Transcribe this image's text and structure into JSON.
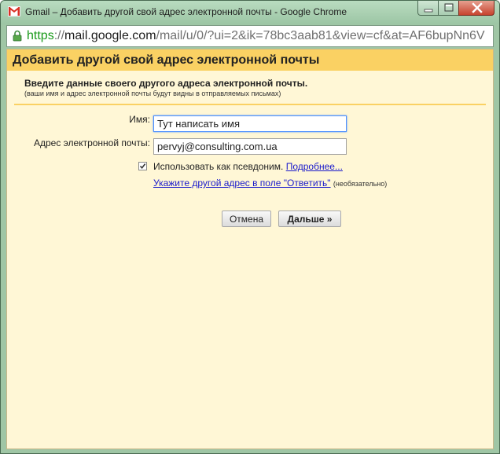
{
  "window": {
    "title": "Gmail – Добавить другой свой адрес электронной почты - Google Chrome",
    "logo_icon": "gmail-logo-icon",
    "controls": [
      "minimize-icon",
      "maximize-icon",
      "close-icon"
    ]
  },
  "addressbar": {
    "scheme": "https",
    "separator": "://",
    "host": "mail.google.com",
    "path": "/mail/u/0/?ui=2&ik=78bc3aab81&view=cf&at=AF6bupNn6V",
    "icon": "lock-icon"
  },
  "dialog": {
    "title": "Добавить другой свой адрес электронной почты",
    "subtitle": "Введите данные своего другого адреса электронной почты.",
    "subnote": "(ваши имя и адрес электронной почты будут видны в отправляемых письмах)",
    "name_label": "Имя:",
    "name_value": "Тут написать имя",
    "email_label": "Адрес электронной почты:",
    "email_value": "pervyj@consulting.com.ua",
    "alias_checked": true,
    "alias_text": "Использовать как псевдоним.",
    "alias_link": "Подробнее...",
    "reply_link": "Укажите другой адрес в поле \"Ответить\"",
    "reply_optional": "(необязательно)",
    "cancel_label": "Отмена",
    "next_label": "Дальше »"
  },
  "colors": {
    "header_band": "#fad163",
    "content_bg": "#fff7d6",
    "link": "#1a1acc",
    "scheme_green": "#1a9a1a"
  }
}
